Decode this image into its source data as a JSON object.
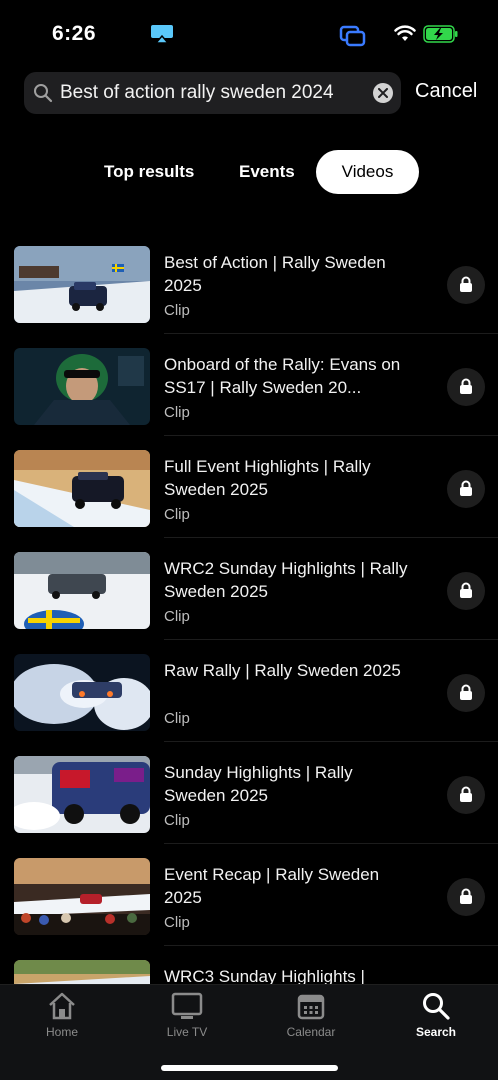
{
  "status": {
    "time": "6:26",
    "icons": [
      "airplay-icon",
      "screen-mirroring-icon",
      "wifi-icon",
      "battery-charging-icon"
    ]
  },
  "search": {
    "query": "Best of action rally sweden 2024",
    "cancel_label": "Cancel"
  },
  "tabs": [
    {
      "label": "Top results",
      "selected": false
    },
    {
      "label": "Events",
      "selected": false
    },
    {
      "label": "Videos",
      "selected": true
    }
  ],
  "results": [
    {
      "title": "Best of Action | Rally Sweden 2025",
      "type": "Clip",
      "locked": true
    },
    {
      "title": "Onboard of the Rally: Evans on SS17  | Rally Sweden 20...",
      "type": "Clip",
      "locked": true
    },
    {
      "title": "Full Event Highlights | Rally Sweden 2025",
      "type": "Clip",
      "locked": true
    },
    {
      "title": "WRC2 Sunday Highlights | Rally Sweden 2025",
      "type": "Clip",
      "locked": true
    },
    {
      "title": "Raw Rally | Rally Sweden 2025",
      "type": "Clip",
      "locked": true
    },
    {
      "title": "Sunday Highlights | Rally Sweden 2025",
      "type": "Clip",
      "locked": true
    },
    {
      "title": "Event Recap | Rally Sweden 2025",
      "type": "Clip",
      "locked": true
    },
    {
      "title": "WRC3 Sunday Highlights |",
      "type": "",
      "locked": false
    }
  ],
  "tabbar": {
    "items": [
      {
        "label": "Home",
        "icon": "home-icon",
        "active": false
      },
      {
        "label": "Live TV",
        "icon": "tv-icon",
        "active": false
      },
      {
        "label": "Calendar",
        "icon": "calendar-icon",
        "active": false
      },
      {
        "label": "Search",
        "icon": "search-icon",
        "active": true
      }
    ]
  },
  "colors": {
    "background": "#000000",
    "search_field": "#1f1f21",
    "tabbar": "#111214",
    "airplay_accent": "#5ac8fa",
    "screens_accent": "#3a7bff",
    "battery_accent": "#32d74b"
  }
}
